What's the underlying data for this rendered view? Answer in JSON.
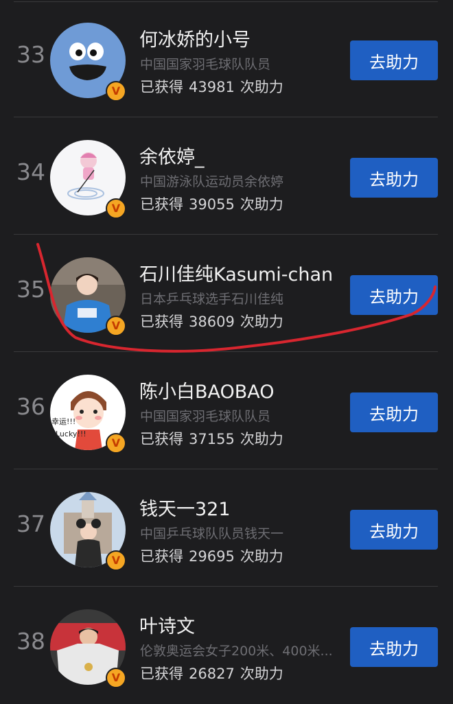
{
  "rows": [
    {
      "rank": "33",
      "name": "何冰娇的小号",
      "desc": "中国国家羽毛球队队员",
      "count_prefix": "已获得",
      "count_value": "43981",
      "count_suffix": "次助力",
      "button": "去助力"
    },
    {
      "rank": "34",
      "name": "余依婷_",
      "desc": "中国游泳队运动员余依婷",
      "count_prefix": "已获得",
      "count_value": "39055",
      "count_suffix": "次助力",
      "button": "去助力"
    },
    {
      "rank": "35",
      "name": "石川佳纯Kasumi-chan",
      "desc": "日本乒乓球选手石川佳纯",
      "count_prefix": "已获得",
      "count_value": "38609",
      "count_suffix": "次助力",
      "button": "去助力"
    },
    {
      "rank": "36",
      "name": "陈小白BAOBAO",
      "desc": "中国国家羽毛球队队员",
      "count_prefix": "已获得",
      "count_value": "37155",
      "count_suffix": "次助力",
      "button": "去助力"
    },
    {
      "rank": "37",
      "name": "钱天一321",
      "desc": "中国乒乓球队队员钱天一",
      "count_prefix": "已获得",
      "count_value": "29695",
      "count_suffix": "次助力",
      "button": "去助力"
    },
    {
      "rank": "38",
      "name": "叶诗文",
      "desc": "伦敦奥运会女子200米、400米...",
      "count_prefix": "已获得",
      "count_value": "26827",
      "count_suffix": "次助力",
      "button": "去助力"
    }
  ],
  "avatar_texts": {
    "lucky_1": "幸运!!!",
    "lucky_2": "Lucky!!!"
  },
  "verified_badge": "V",
  "colors": {
    "background": "#1d1d1f",
    "button": "#1f5fc2",
    "annotation": "#d8262f"
  }
}
